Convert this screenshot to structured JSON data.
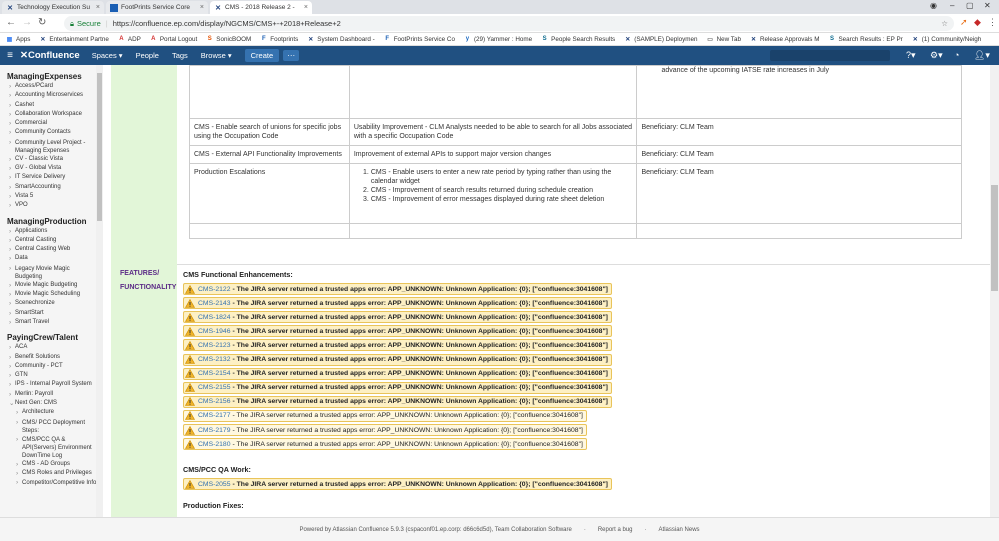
{
  "browser": {
    "tabs": [
      {
        "title": "Technology Execution Su",
        "icon": "X"
      },
      {
        "title": "FootPrints Service Core",
        "icon": "F"
      },
      {
        "title": "CMS - 2018 Release 2 - ",
        "icon": "X"
      }
    ],
    "secure_label": "Secure",
    "url": "https://confluence.ep.com/display/NGCMS/CMS+-+2018+Release+2",
    "bookmarks": [
      {
        "label": "Apps",
        "icon": "grid-icon"
      },
      {
        "label": "Entertainment Partne",
        "icon": "ep-icon"
      },
      {
        "label": "ADP",
        "icon": "adp-icon"
      },
      {
        "label": "Portal Logout",
        "icon": "adp-icon"
      },
      {
        "label": "SonicBOOM",
        "icon": "sonicboom-icon"
      },
      {
        "label": "Footprints",
        "icon": "footprints-icon"
      },
      {
        "label": "System Dashboard -",
        "icon": "jira-icon"
      },
      {
        "label": "FootPrints Service Co",
        "icon": "footprints-icon"
      },
      {
        "label": "(29) Yammer : Home",
        "icon": "yammer-icon"
      },
      {
        "label": "People Search Results",
        "icon": "sharepoint-icon"
      },
      {
        "label": "(SAMPLE) Deploymen",
        "icon": "x-icon"
      },
      {
        "label": "New Tab",
        "icon": "page-icon"
      },
      {
        "label": "Release Approvals M",
        "icon": "x-icon"
      },
      {
        "label": "Search Results : EP Pr",
        "icon": "sharepoint-icon"
      },
      {
        "label": "(1) Community/Neigh",
        "icon": "x-icon"
      }
    ]
  },
  "header": {
    "logo": "Confluence",
    "nav": [
      "Spaces ▾",
      "People",
      "Tags",
      "Browse ▾"
    ],
    "create": "Create",
    "more": "···"
  },
  "sidebar": {
    "groups": [
      {
        "title": "ManagingExpenses",
        "items": [
          {
            "label": "Access/PCard"
          },
          {
            "label": "Accounting Microservices"
          },
          {
            "label": "Cashet"
          },
          {
            "label": "Collaboration Workspace"
          },
          {
            "label": "Commercial"
          },
          {
            "label": "Community Contacts"
          },
          {
            "label": "Community Level Project - Managing Expenses",
            "wrap": true
          },
          {
            "label": "CV - Classic Vista"
          },
          {
            "label": "GV - Global Vista"
          },
          {
            "label": "IT Service Delivery"
          },
          {
            "label": "SmartAccounting"
          },
          {
            "label": "Vista 5"
          },
          {
            "label": "VPO"
          }
        ]
      },
      {
        "title": "ManagingProduction",
        "items": [
          {
            "label": "Applications"
          },
          {
            "label": "Central Casting"
          },
          {
            "label": "Central Casting Web"
          },
          {
            "label": "Data"
          },
          {
            "label": "Legacy Movie Magic Budgeting",
            "wrap": true
          },
          {
            "label": "Movie Magic Budgeting"
          },
          {
            "label": "Movie Magic Scheduling"
          },
          {
            "label": "Scenechronize"
          },
          {
            "label": "SmartStart"
          },
          {
            "label": "Smart Travel"
          }
        ]
      },
      {
        "title": "PayingCrew/Talent",
        "items": [
          {
            "label": "ACA"
          },
          {
            "label": "Benefit Solutions"
          },
          {
            "label": "Community - PCT"
          },
          {
            "label": "GTN"
          },
          {
            "label": "IPS - Internal Payroll System"
          },
          {
            "label": "Merlin: Payroll"
          },
          {
            "label": "Next Gen: CMS",
            "open": true
          },
          {
            "label": "Architecture",
            "level": 2
          },
          {
            "label": "CMS/ PCC Deployment Steps:",
            "level": 2,
            "wrap": true
          },
          {
            "label": "CMS/PCC QA & API(Servers) Environment DownTime Log",
            "level": 2,
            "wrap": true
          },
          {
            "label": "CMS - AD Groups",
            "level": 2
          },
          {
            "label": "CMS Roles and Privileges",
            "level": 2
          },
          {
            "label": "Competitor/Competitive Info",
            "level": 2,
            "wrap": true
          }
        ]
      }
    ]
  },
  "table": {
    "top_fragment": "advance of the upcoming IATSE rate increases in July",
    "rows": [
      {
        "feature": "CMS - Enable search of unions for specific jobs using the Occupation Code",
        "description": "Usability Improvement - CLM Analysts needed to be able to search for all Jobs associated with a specific Occupation Code",
        "beneficiary": "Beneficiary: CLM Team"
      },
      {
        "feature": "CMS - External API Functionality Improvements",
        "description": "Improvement of external APIs to support major version changes",
        "beneficiary": "Beneficiary: CLM Team"
      },
      {
        "feature": "Production Escalations",
        "list": [
          "CMS - Enable users to enter a new rate period by typing rather than using the calendar widget",
          "CMS - Improvement of search results returned during schedule creation",
          "CMS - Improvement of error messages displayed during rate sheet deletion"
        ],
        "beneficiary": "Beneficiary: CLM Team"
      }
    ]
  },
  "features": {
    "label_line1": "FEATURES/",
    "label_line2": "FUNCTIONALITY",
    "functional_title": "CMS Functional Enhancements:",
    "qa_title": "CMS/PCC QA Work:",
    "fixes_title": "Production Fixes:",
    "error_bold": " - The JIRA server returned a trusted apps error: APP_UNKNOWN: Unknown Application: {0}; [\"confluence:3041608\"]",
    "error_plain": " - The JIRA server returned a trusted apps error: APP_UNKNOWN: Unknown Application: {0}; [\"confluence:3041608\"]",
    "functional_issues": [
      {
        "key": "CMS-2122",
        "bold": true
      },
      {
        "key": "CMS-2143",
        "bold": true
      },
      {
        "key": "CMS-1824",
        "bold": true
      },
      {
        "key": "CMS-1946",
        "bold": true
      },
      {
        "key": "CMS-2123",
        "bold": true
      },
      {
        "key": "CMS-2132",
        "bold": true
      },
      {
        "key": "CMS-2154",
        "bold": true
      },
      {
        "key": "CMS-2155",
        "bold": true
      },
      {
        "key": "CMS-2156",
        "bold": true
      },
      {
        "key": "CMS-2177",
        "bold": false
      },
      {
        "key": "CMS-2179",
        "bold": false
      },
      {
        "key": "CMS-2180",
        "bold": false
      }
    ],
    "qa_issues": [
      {
        "key": "CMS-2055",
        "bold": true
      }
    ]
  },
  "footer": {
    "powered": "Powered by Atlassian Confluence 5.9.3 (cspaconf01.ep.corp: d66c6d5d), Team Collaboration Software",
    "report": "Report a bug",
    "news": "Atlassian News"
  },
  "colors": {
    "header": "#205081",
    "feature_label": "#5b2a86",
    "feature_column": "#e2f6d8",
    "warning_fill": "#fdf0c4",
    "link": "#3572b0"
  }
}
